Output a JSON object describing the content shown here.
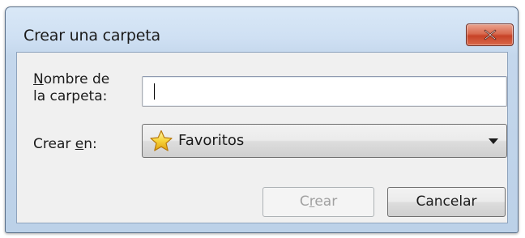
{
  "window": {
    "title": "Crear una carpeta"
  },
  "form": {
    "name_label_line1_first": "N",
    "name_label_line1_rest": "ombre de",
    "name_label_line2": "la carpeta:",
    "name_value": "",
    "create_in_label_prefix": "Crear ",
    "create_in_label_underlined": "e",
    "create_in_label_suffix": "n:",
    "create_in_value": "Favoritos",
    "create_in_icon": "star-icon"
  },
  "buttons": {
    "create_prefix": "C",
    "create_underlined": "r",
    "create_suffix": "ear",
    "cancel": "Cancelar"
  },
  "colors": {
    "close_button": "#c74328",
    "disabled_text": "#a0a0a0"
  }
}
